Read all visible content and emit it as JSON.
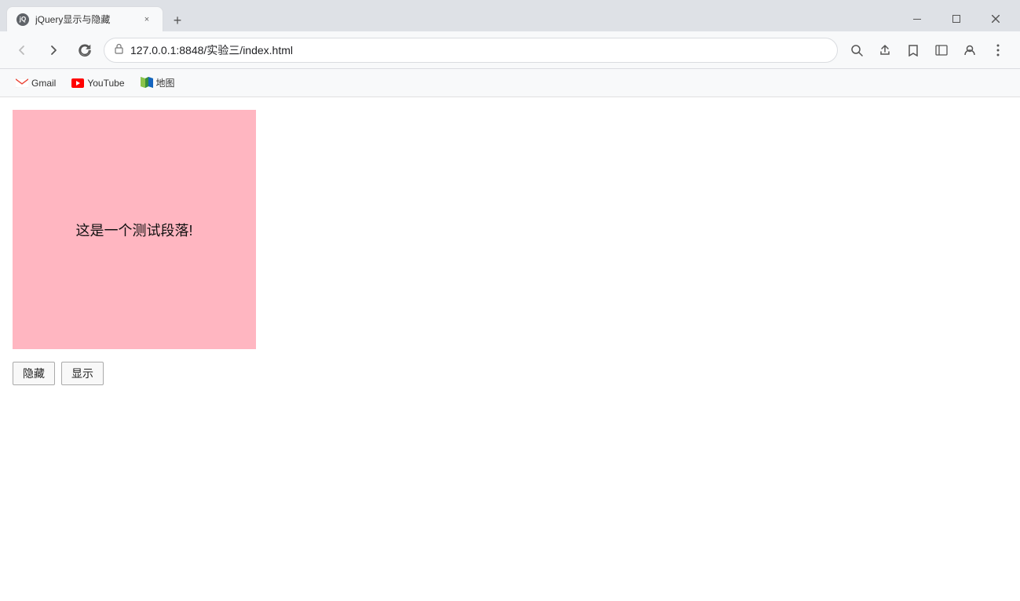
{
  "browser": {
    "tab": {
      "favicon_label": "jQ",
      "title": "jQuery显示与隐藏",
      "close_label": "×"
    },
    "new_tab_label": "+",
    "window_controls": {
      "minimize": "—",
      "maximize": "□",
      "close": "✕"
    },
    "nav": {
      "back_label": "←",
      "forward_label": "→",
      "refresh_label": "↻",
      "address_lock": "ⓘ",
      "address_url": "127.0.0.1:8848/实验三/index.html",
      "zoom_icon": "🔍",
      "share_icon": "⬆",
      "star_icon": "☆",
      "sidebar_icon": "▭",
      "profile_icon": "👤",
      "menu_icon": "⋮"
    },
    "bookmarks": [
      {
        "id": "gmail",
        "icon_type": "gmail",
        "label": "Gmail"
      },
      {
        "id": "youtube",
        "icon_type": "youtube",
        "label": "YouTube"
      },
      {
        "id": "maps",
        "icon_type": "maps",
        "label": "地图"
      }
    ]
  },
  "page": {
    "pink_box_text": "这是一个测试段落!",
    "hide_button_label": "隐藏",
    "show_button_label": "显示"
  }
}
